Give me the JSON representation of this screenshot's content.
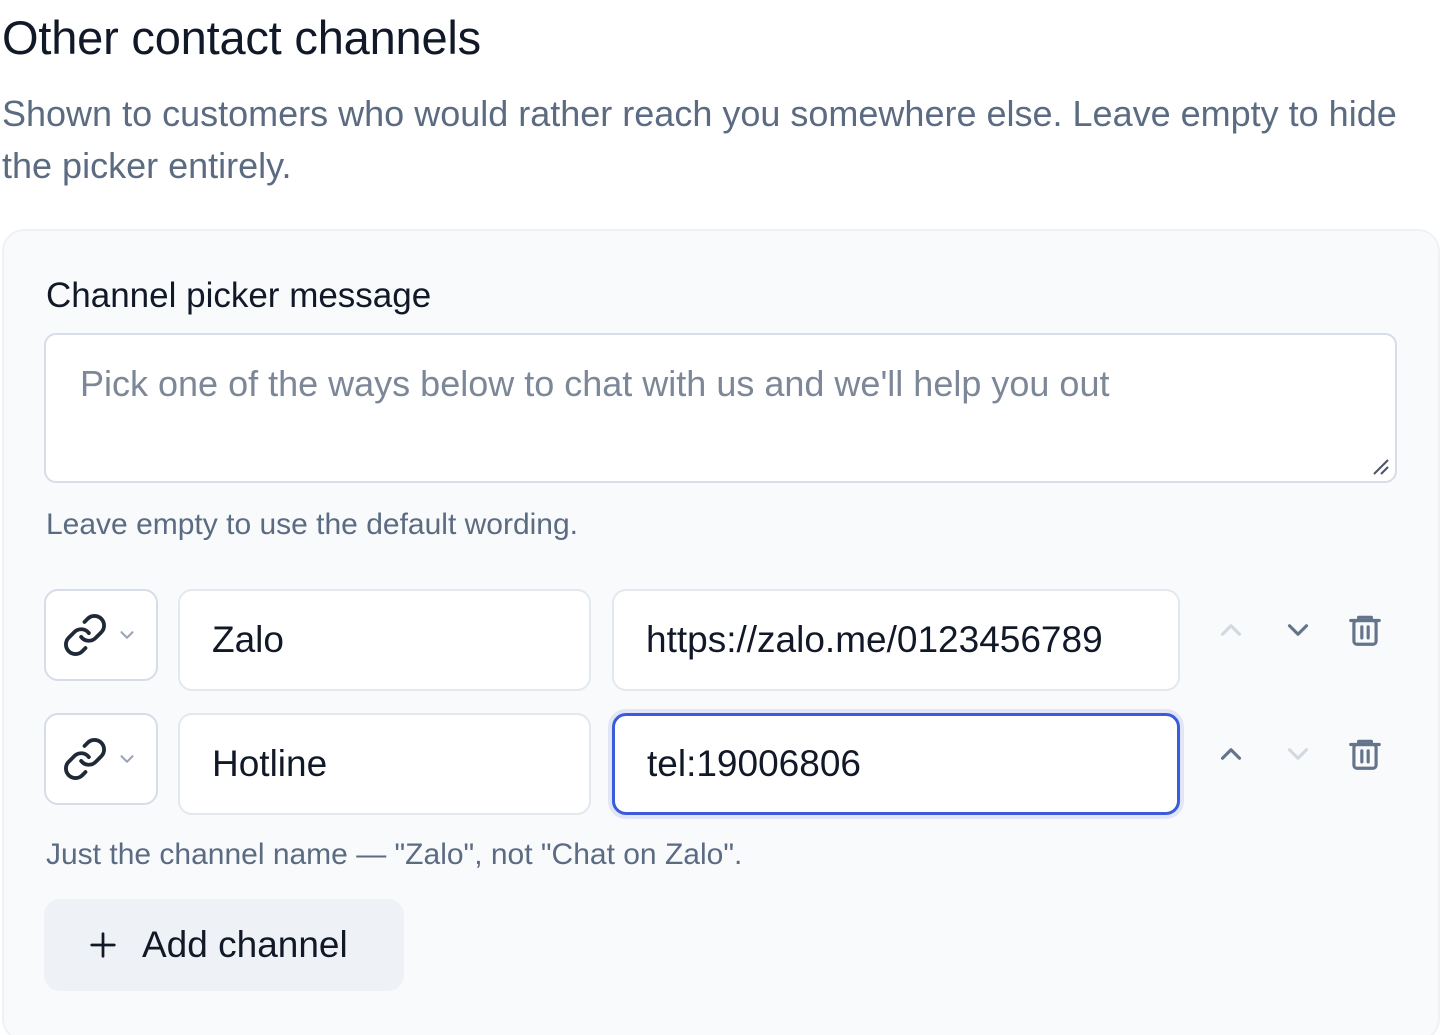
{
  "section": {
    "title": "Other contact channels",
    "description": "Shown to customers who would rather reach you somewhere else. Leave empty to hide the picker entirely."
  },
  "picker_message": {
    "label": "Channel picker message",
    "placeholder": "Pick one of the ways below to chat with us and we'll help you out",
    "hint": "Leave empty to use the default wording."
  },
  "channels": [
    {
      "icon": "link-icon",
      "name": "Zalo",
      "url": "https://zalo.me/0123456789",
      "move_up_enabled": false,
      "move_down_enabled": true
    },
    {
      "icon": "link-icon",
      "name": "Hotline",
      "url": "tel:19006806",
      "move_up_enabled": true,
      "move_down_enabled": false
    }
  ],
  "channel_name_hint": "Just the channel name — \"Zalo\", not \"Chat on Zalo\".",
  "add_button": {
    "icon": "plus-icon",
    "label": "Add channel"
  },
  "colors": {
    "focus_border": "#3b5bdb",
    "muted_text": "#5b6b82",
    "card_background": "#f8fafc",
    "disabled_control": "#d3d9e1",
    "control": "#64748b"
  }
}
